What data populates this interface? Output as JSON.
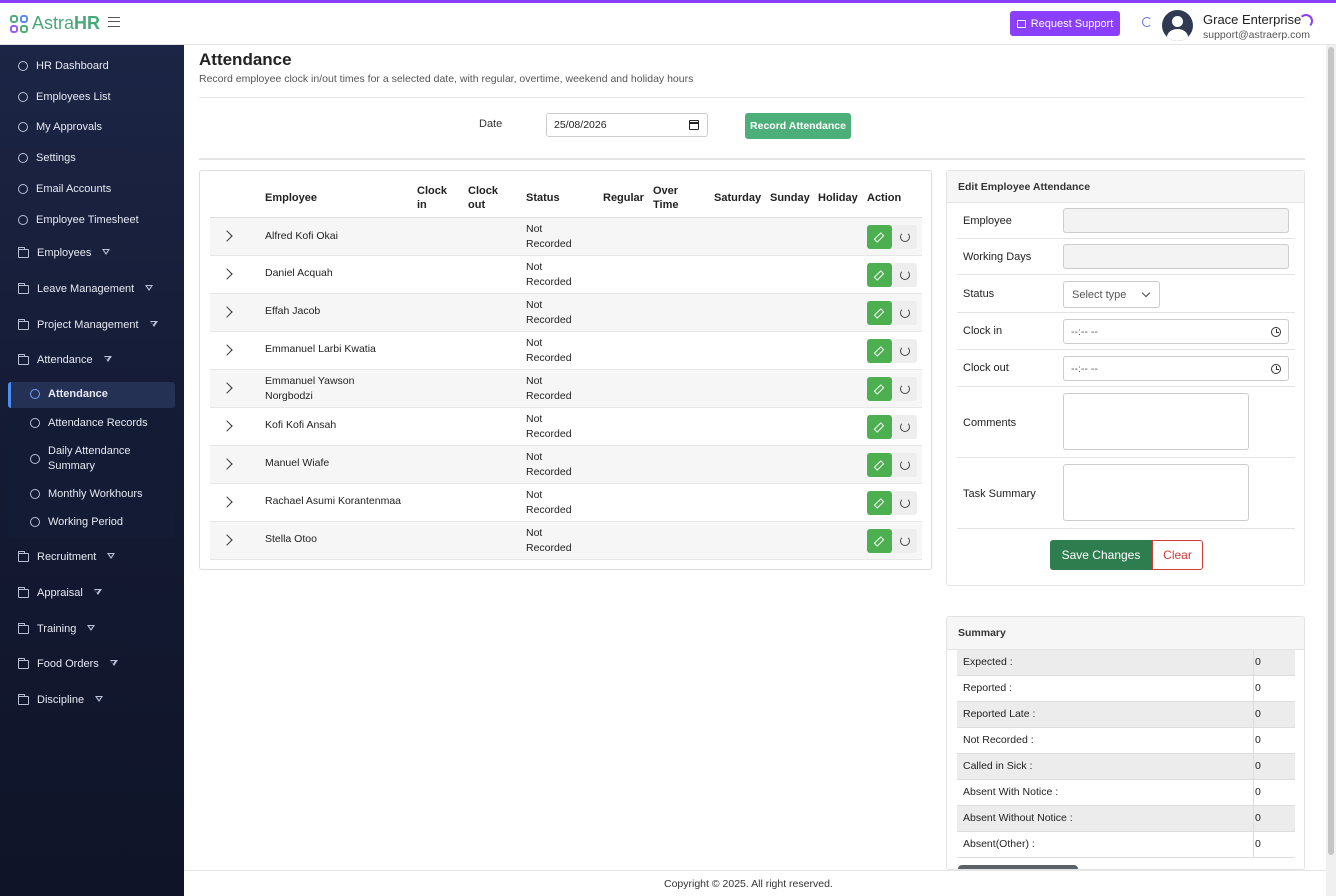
{
  "app": {
    "logo_plain": "Astra",
    "logo_bold": "HR",
    "support_label": "Request Support",
    "user_name": "Grace Enterprise",
    "user_email": "support@astraerp.com"
  },
  "sidebar": {
    "items": [
      {
        "label": "HR Dashboard",
        "icon": "circle-icon"
      },
      {
        "label": "Employees List",
        "icon": "circle-icon"
      },
      {
        "label": "My Approvals",
        "icon": "circle-icon"
      },
      {
        "label": "Settings",
        "icon": "circle-icon"
      },
      {
        "label": "Email Accounts",
        "icon": "circle-icon"
      },
      {
        "label": "Employee Timesheet",
        "icon": "circle-icon"
      },
      {
        "label": "Employees",
        "icon": "folder-icon"
      },
      {
        "label": "Leave Management",
        "icon": "folder-icon"
      },
      {
        "label": "Project Management",
        "icon": "folder-icon"
      },
      {
        "label": "Attendance",
        "icon": "folder-icon"
      },
      {
        "label": "Recruitment",
        "icon": "folder-icon"
      },
      {
        "label": "Appraisal",
        "icon": "folder-icon"
      },
      {
        "label": "Training",
        "icon": "folder-icon"
      },
      {
        "label": "Food Orders",
        "icon": "folder-icon"
      },
      {
        "label": "Discipline",
        "icon": "folder-icon"
      }
    ],
    "submenu": [
      {
        "label": "Attendance",
        "active": true
      },
      {
        "label": "Attendance Records"
      },
      {
        "label": "Daily Attendance Summary"
      },
      {
        "label": "Monthly Workhours"
      },
      {
        "label": "Working Period"
      }
    ]
  },
  "page": {
    "title": "Attendance",
    "subtitle": "Record employee clock in/out times for a selected date, with regular, overtime, weekend and holiday hours",
    "date_label": "Date",
    "date_value": "25/08/2026",
    "record_label": "Record Attendance"
  },
  "table": {
    "headers": [
      "Employee",
      "Clock in",
      "Clock out",
      "Status",
      "Regular",
      "Over Time",
      "Saturday",
      "Sunday",
      "Holiday",
      "Action"
    ],
    "rows": [
      {
        "name": "Alfred Kofi Okai",
        "status": "Not Recorded"
      },
      {
        "name": "Daniel Acquah",
        "status": "Not Recorded"
      },
      {
        "name": "Effah Jacob",
        "status": "Not Recorded"
      },
      {
        "name": "Emmanuel Larbi Kwatia",
        "status": "Not Recorded"
      },
      {
        "name": "Emmanuel Yawson Norgbodzi",
        "status": "Not Recorded"
      },
      {
        "name": "Kofi Kofi Ansah",
        "status": "Not Recorded"
      },
      {
        "name": "Manuel Wiafe",
        "status": "Not Recorded"
      },
      {
        "name": "Rachael Asumi Korantenmaa",
        "status": "Not Recorded"
      },
      {
        "name": "Stella Otoo",
        "status": "Not Recorded"
      }
    ]
  },
  "edit_form": {
    "title": "Edit Employee Attendance",
    "employee_label": "Employee",
    "working_days_label": "Working Days",
    "status_label": "Status",
    "status_placeholder": "Select type",
    "clock_in_label": "Clock in",
    "clock_in_placeholder": "--:-- --",
    "clock_out_label": "Clock out",
    "clock_out_placeholder": "--:-- --",
    "comments_label": "Comments",
    "task_summary_label": "Task Summary",
    "save_label": "Save Changes",
    "clear_label": "Clear"
  },
  "summary": {
    "title": "Summary",
    "rows": [
      {
        "label": "Expected :",
        "value": "0"
      },
      {
        "label": "Reported :",
        "value": "0"
      },
      {
        "label": "Reported Late :",
        "value": "0"
      },
      {
        "label": "Not Recorded :",
        "value": "0"
      },
      {
        "label": "Called in Sick :",
        "value": "0"
      },
      {
        "label": "Absent With Notice :",
        "value": "0"
      },
      {
        "label": "Absent Without Notice :",
        "value": "0"
      },
      {
        "label": "Absent(Other) :",
        "value": "0"
      }
    ]
  },
  "footer": {
    "copyright": "Copyright © 2025. All right reserved."
  },
  "colors": {
    "accent": "#8a3ffc",
    "success": "#4caf79",
    "save": "#2e7d4f",
    "danger": "#d23b3b"
  }
}
